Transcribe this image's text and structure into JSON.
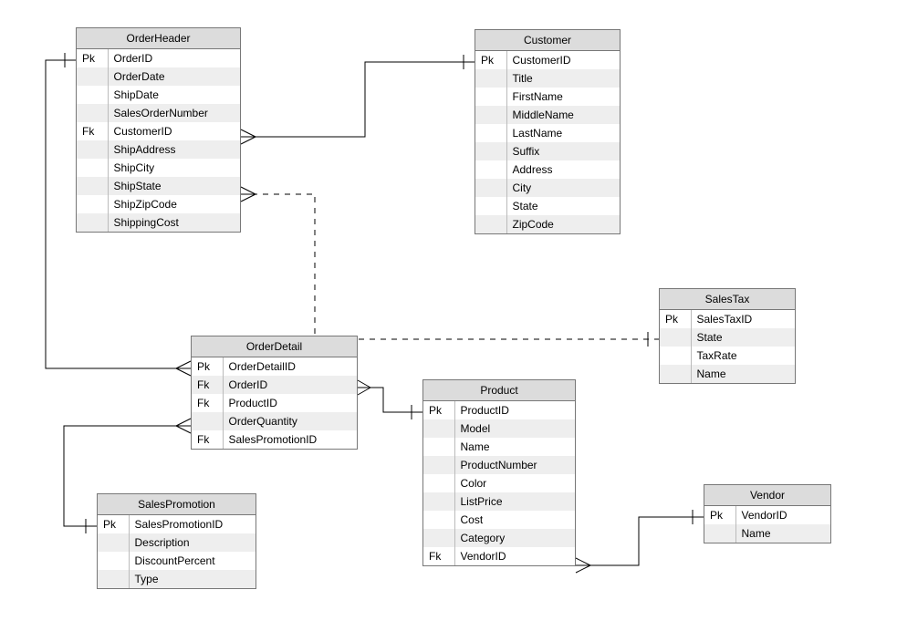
{
  "chart_data": {
    "type": "er-diagram",
    "relationships": [
      {
        "from": "OrderHeader.CustomerID",
        "to": "Customer.CustomerID",
        "kind": "many-to-one"
      },
      {
        "from": "OrderHeader.ShipState",
        "to": "SalesTax.SalesTaxID",
        "kind": "many-to-one",
        "dashed": true
      },
      {
        "from": "OrderDetail.OrderID",
        "to": "OrderHeader.OrderID",
        "kind": "many-to-one"
      },
      {
        "from": "OrderDetail.ProductID",
        "to": "Product.ProductID",
        "kind": "many-to-one"
      },
      {
        "from": "OrderDetail.SalesPromotionID",
        "to": "SalesPromotion.SalesPromotionID",
        "kind": "many-to-one"
      },
      {
        "from": "Product.VendorID",
        "to": "Vendor.VendorID",
        "kind": "many-to-one"
      }
    ]
  },
  "entities": {
    "OrderHeader": {
      "title": "OrderHeader",
      "attrs": [
        {
          "key": "Pk",
          "name": "OrderID"
        },
        {
          "key": "",
          "name": "OrderDate"
        },
        {
          "key": "",
          "name": "ShipDate"
        },
        {
          "key": "",
          "name": "SalesOrderNumber"
        },
        {
          "key": "Fk",
          "name": "CustomerID"
        },
        {
          "key": "",
          "name": "ShipAddress"
        },
        {
          "key": "",
          "name": "ShipCity"
        },
        {
          "key": "",
          "name": "ShipState"
        },
        {
          "key": "",
          "name": "ShipZipCode"
        },
        {
          "key": "",
          "name": "ShippingCost"
        }
      ]
    },
    "Customer": {
      "title": "Customer",
      "attrs": [
        {
          "key": "Pk",
          "name": "CustomerID"
        },
        {
          "key": "",
          "name": "Title"
        },
        {
          "key": "",
          "name": "FirstName"
        },
        {
          "key": "",
          "name": "MiddleName"
        },
        {
          "key": "",
          "name": "LastName"
        },
        {
          "key": "",
          "name": "Suffix"
        },
        {
          "key": "",
          "name": "Address"
        },
        {
          "key": "",
          "name": "City"
        },
        {
          "key": "",
          "name": "State"
        },
        {
          "key": "",
          "name": "ZipCode"
        }
      ]
    },
    "SalesTax": {
      "title": "SalesTax",
      "attrs": [
        {
          "key": "Pk",
          "name": "SalesTaxID"
        },
        {
          "key": "",
          "name": "State"
        },
        {
          "key": "",
          "name": "TaxRate"
        },
        {
          "key": "",
          "name": "Name"
        }
      ]
    },
    "OrderDetail": {
      "title": "OrderDetail",
      "attrs": [
        {
          "key": "Pk",
          "name": "OrderDetailID"
        },
        {
          "key": "Fk",
          "name": "OrderID"
        },
        {
          "key": "Fk",
          "name": "ProductID"
        },
        {
          "key": "",
          "name": "OrderQuantity"
        },
        {
          "key": "Fk",
          "name": "SalesPromotionID"
        }
      ]
    },
    "Product": {
      "title": "Product",
      "attrs": [
        {
          "key": "Pk",
          "name": "ProductID"
        },
        {
          "key": "",
          "name": "Model"
        },
        {
          "key": "",
          "name": "Name"
        },
        {
          "key": "",
          "name": "ProductNumber"
        },
        {
          "key": "",
          "name": "Color"
        },
        {
          "key": "",
          "name": "ListPrice"
        },
        {
          "key": "",
          "name": "Cost"
        },
        {
          "key": "",
          "name": "Category"
        },
        {
          "key": "Fk",
          "name": "VendorID"
        }
      ]
    },
    "SalesPromotion": {
      "title": "SalesPromotion",
      "attrs": [
        {
          "key": "Pk",
          "name": "SalesPromotionID"
        },
        {
          "key": "",
          "name": "Description"
        },
        {
          "key": "",
          "name": "DiscountPercent"
        },
        {
          "key": "",
          "name": "Type"
        }
      ]
    },
    "Vendor": {
      "title": "Vendor",
      "attrs": [
        {
          "key": "Pk",
          "name": "VendorID"
        },
        {
          "key": "",
          "name": "Name"
        }
      ]
    }
  }
}
